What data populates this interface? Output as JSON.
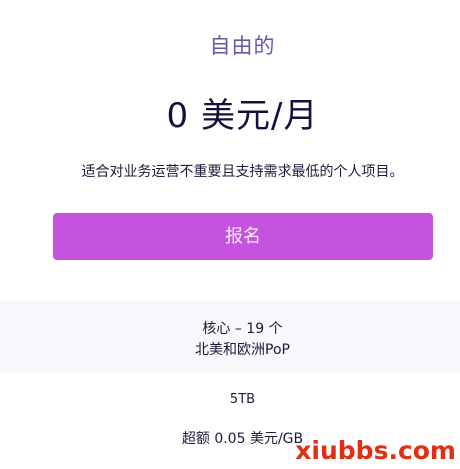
{
  "plan": {
    "name": "自由的",
    "price": "0 美元/月",
    "description": "适合对业务运营不重要且支持需求最低的个人项目。",
    "signup_label": "报名"
  },
  "features": {
    "cores": "核心 – 19 个",
    "regions": "北美和欧洲PoP"
  },
  "storage": "5TB",
  "overage": "超额 0.05 美元/GB",
  "watermark": "xiubbs.com",
  "colors": {
    "plan_name": "#6b55a6",
    "price": "#150f3b",
    "button": "#c653e0",
    "feature_band": "#f8f7fc",
    "watermark": "#e12f14"
  }
}
